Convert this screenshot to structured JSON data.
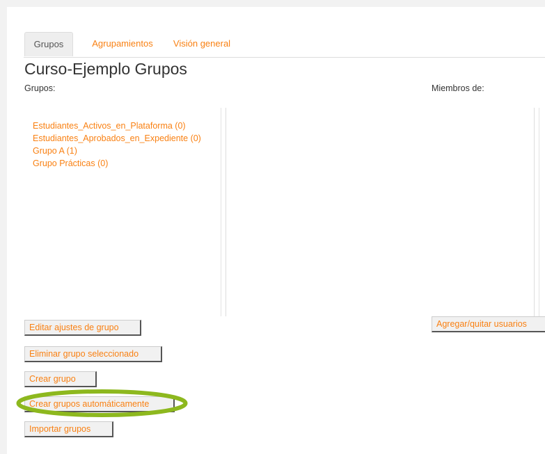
{
  "tabs": [
    {
      "label": "Grupos",
      "active": true
    },
    {
      "label": "Agrupamientos",
      "active": false
    },
    {
      "label": "Visión general",
      "active": false
    }
  ],
  "page_title": "Curso-Ejemplo Grupos",
  "groups_label": "Grupos:",
  "members_label": "Miembros de:",
  "groups": [
    "Estudiantes_Activos_en_Plataforma (0)",
    "Estudiantes_Aprobados_en_Expediente (0)",
    "Grupo A (1)",
    "Grupo Prácticas (0)"
  ],
  "buttons": {
    "edit": "Editar ajustes de grupo",
    "delete": "Eliminar grupo seleccionado",
    "create": "Crear grupo",
    "auto_create": "Crear grupos automáticamente",
    "import": "Importar grupos",
    "add_remove_users": "Agregar/quitar usuarios"
  },
  "colors": {
    "link": "#f98012",
    "highlight_ring": "#8db81e"
  }
}
